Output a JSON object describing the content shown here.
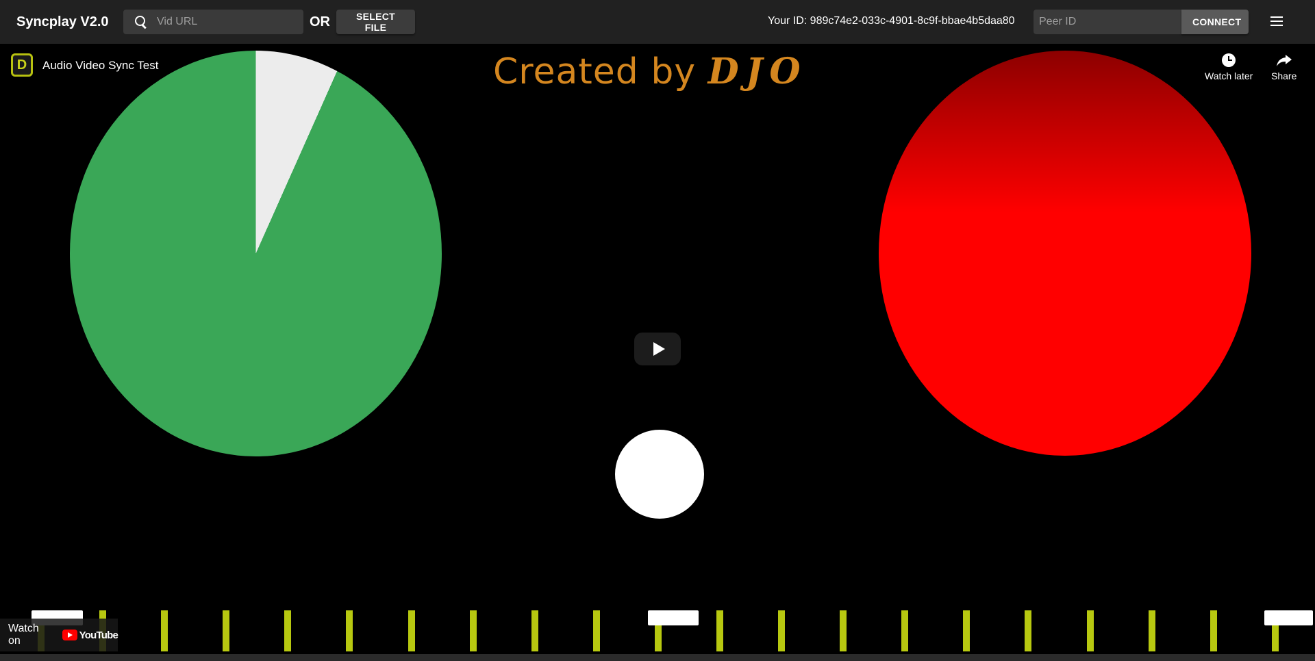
{
  "appbar": {
    "title": "Syncplay V2.0",
    "search_placeholder": "Vid URL",
    "or_label": "OR",
    "select_file_label": "SELECT FILE",
    "your_id_label": "Your ID: 989c74e2-033c-4901-8c9f-bbae4b5daa80",
    "peer_placeholder": "Peer ID",
    "connect_label": "CONNECT",
    "menu_icon": "hamburger-menu-icon"
  },
  "player": {
    "channel_badge": "D",
    "video_title": "Audio Video Sync Test",
    "watch_later_label": "Watch later",
    "share_label": "Share",
    "watch_on_label": "Watch on",
    "youtube_label": "YouTube",
    "overlay_text_prefix": "Created by",
    "overlay_text_brand": "DJO",
    "colors": {
      "green_circle": "#3aa757",
      "red_circle": "#ff0000",
      "bar": "#b7c810"
    }
  }
}
